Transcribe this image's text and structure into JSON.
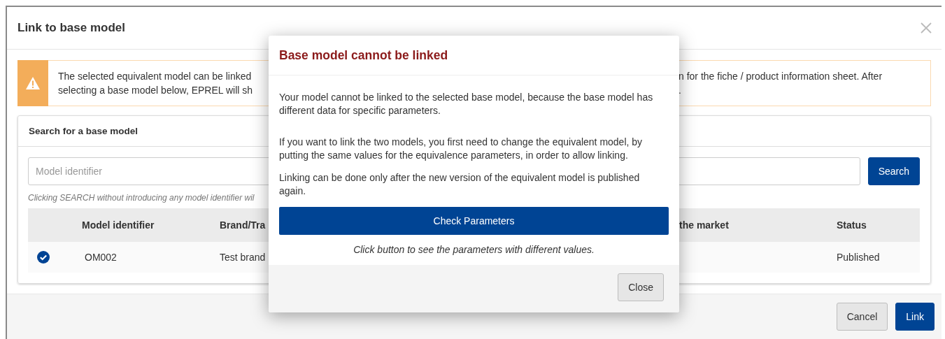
{
  "dialog": {
    "title": "Link to base model"
  },
  "alert": {
    "lines": [
      {
        "start": "The selected equivalent model can be linked",
        "end": "n for the fiche / product information sheet. After"
      },
      {
        "start": "selecting a base model below, EPREL will sh",
        "end": "."
      }
    ]
  },
  "search_card": {
    "title": "Search for a base model",
    "input": {
      "placeholder": "Model identifier"
    },
    "button": "Search",
    "hint": "Clicking SEARCH without introducing any model identifier wil",
    "table": {
      "columns": [
        {
          "label": "Model identifier"
        },
        {
          "label": "Brand/Tra"
        },
        {
          "label": "the market"
        },
        {
          "label": "Status"
        }
      ],
      "rows": [
        {
          "selected": true,
          "model_identifier": "OM002",
          "brand_column": "Test brand",
          "status": "Published"
        }
      ]
    }
  },
  "footer_buttons": [
    {
      "label": "Cancel",
      "kind": "secondary"
    },
    {
      "label": "Link",
      "kind": "primary"
    }
  ],
  "modal": {
    "title": "Base model cannot be linked",
    "paragraphs": [
      "Your model cannot be linked to the selected base model, because the base model has different data for specific parameters.",
      "If you want to link the two models, you first need to change the equivalent model, by putting the same values for the equivalence parameters, in order to allow linking.",
      "Linking can be done only after the new version of the equivalent model is published again."
    ],
    "button": "Check Parameters",
    "hint": "Click button to see the parameters with different values.",
    "close_button": "Close"
  }
}
